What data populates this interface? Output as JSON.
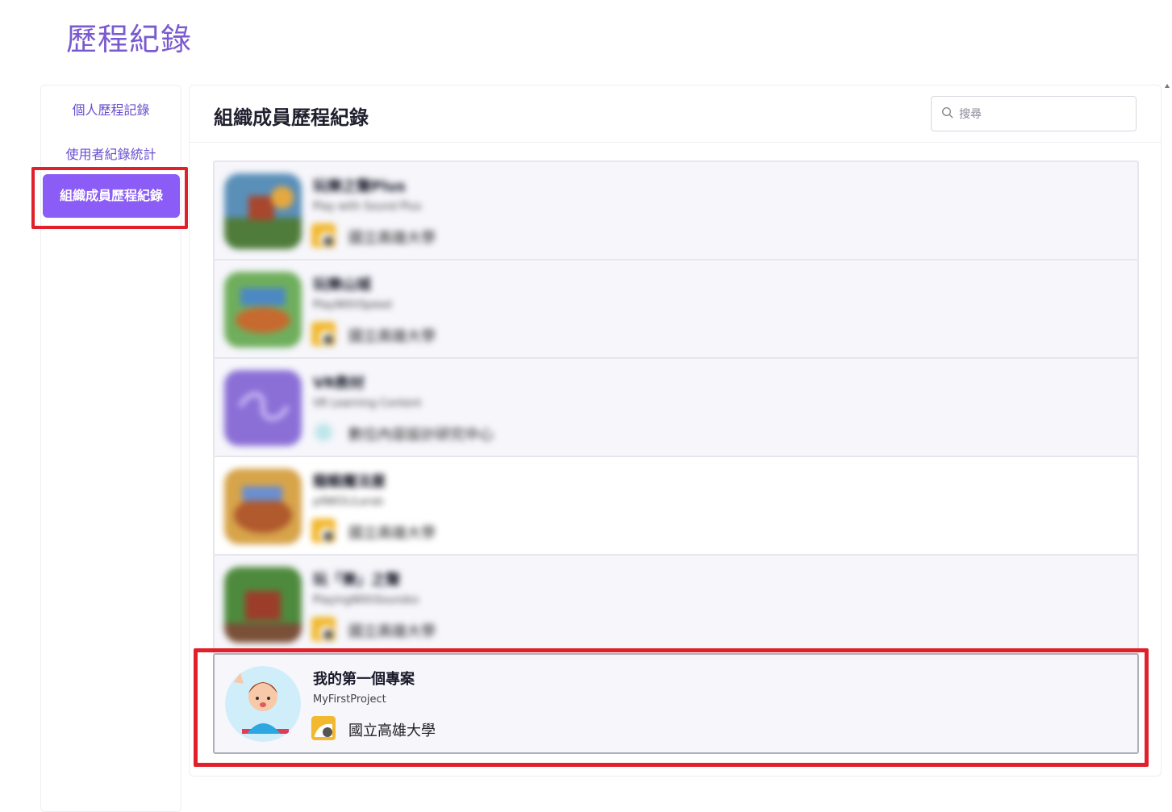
{
  "page": {
    "title": "歷程紀錄"
  },
  "sidebar": {
    "items": [
      {
        "label": "個人歷程記錄"
      },
      {
        "label": "使用者紀錄統計"
      },
      {
        "label": "組織成員歷程紀錄"
      }
    ]
  },
  "panel": {
    "title": "組織成員歷程紀錄",
    "search": {
      "placeholder": "搜尋",
      "value": ""
    }
  },
  "projects": [
    {
      "title": "玩樂之聲Plus",
      "subtitle": "Play with Sound Plus",
      "org": "國立高雄大學",
      "blurred": true
    },
    {
      "title": "玩樂山城",
      "subtitle": "PlayWithSpeed",
      "org": "國立高雄大學",
      "blurred": true
    },
    {
      "title": "VR教材",
      "subtitle": "VR Learning Content",
      "org": "數位內容設計研究中心",
      "blurred": true
    },
    {
      "title": "龍蝦魔法屋",
      "subtitle": "pINKOLiLarab",
      "org": "國立高雄大學",
      "blurred": true
    },
    {
      "title": "玩「樂」之聲",
      "subtitle": "PlayingWithSoundss",
      "org": "國立高雄大學",
      "blurred": true
    },
    {
      "title": "我的第一個專案",
      "subtitle": "MyFirstProject",
      "org": "國立高雄大學",
      "blurred": false
    }
  ],
  "colors": {
    "accent": "#8b5cf6",
    "title": "#7a5ad0",
    "annotation": "#e0202a"
  }
}
